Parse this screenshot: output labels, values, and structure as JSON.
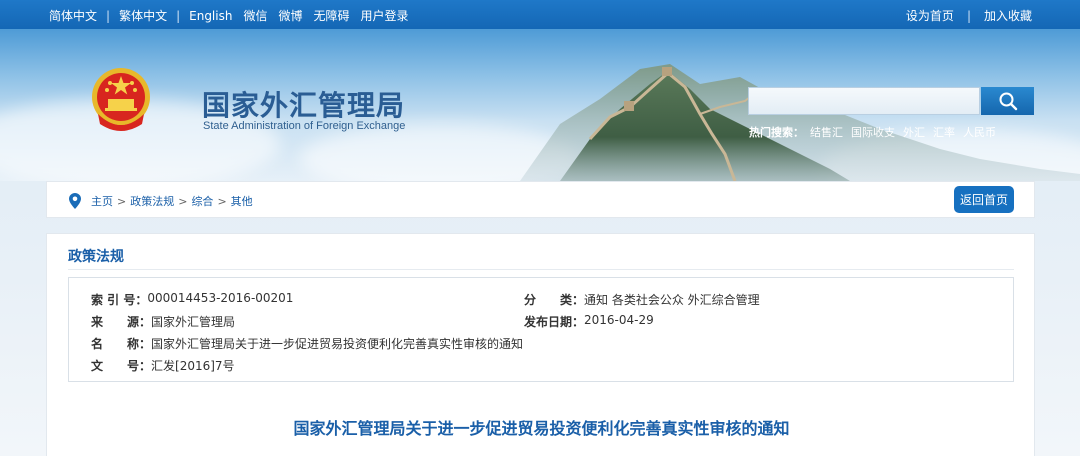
{
  "topbar": {
    "links_left": [
      "简体中文",
      "繁体中文",
      "English",
      "微信",
      "微博",
      "无障碍",
      "用户登录"
    ],
    "links_right": [
      "设为首页",
      "加入收藏"
    ]
  },
  "header": {
    "title_cn": "国家外汇管理局",
    "title_en": "State Administration of Foreign Exchange",
    "search_placeholder": "",
    "hot_label": "热门搜索：",
    "hot_terms": [
      "结售汇",
      "国际收支",
      "外汇",
      "汇率",
      "人民币"
    ]
  },
  "breadcrumb": {
    "items": [
      "主页",
      "政策法规",
      "综合",
      "其他"
    ],
    "separator": ">",
    "home_button": "返回首页"
  },
  "panel": {
    "title": "政策法规",
    "meta": {
      "index_label": "索 引 号：",
      "index_value": "000014453-2016-00201",
      "category_label": "分　　类：",
      "category_value": "通知  各类社会公众  外汇综合管理",
      "source_label": "来　　源：",
      "source_value": "国家外汇管理局",
      "date_label": "发布日期：",
      "date_value": "2016-04-29",
      "name_label": "名　　称：",
      "name_value": "国家外汇管理局关于进一步促进贸易投资便利化完善真实性审核的通知",
      "docno_label": "文　　号：",
      "docno_value": "汇发[2016]7号"
    },
    "doc_title": "国家外汇管理局关于进一步促进贸易投资便利化完善真实性审核的通知"
  },
  "colors": {
    "topbar": "#1467b5",
    "accent": "#1a5fa8",
    "button": "#1670c0"
  },
  "icons": {
    "emblem": "national-emblem-icon",
    "search": "magnifier-icon",
    "location": "location-pin-icon"
  }
}
